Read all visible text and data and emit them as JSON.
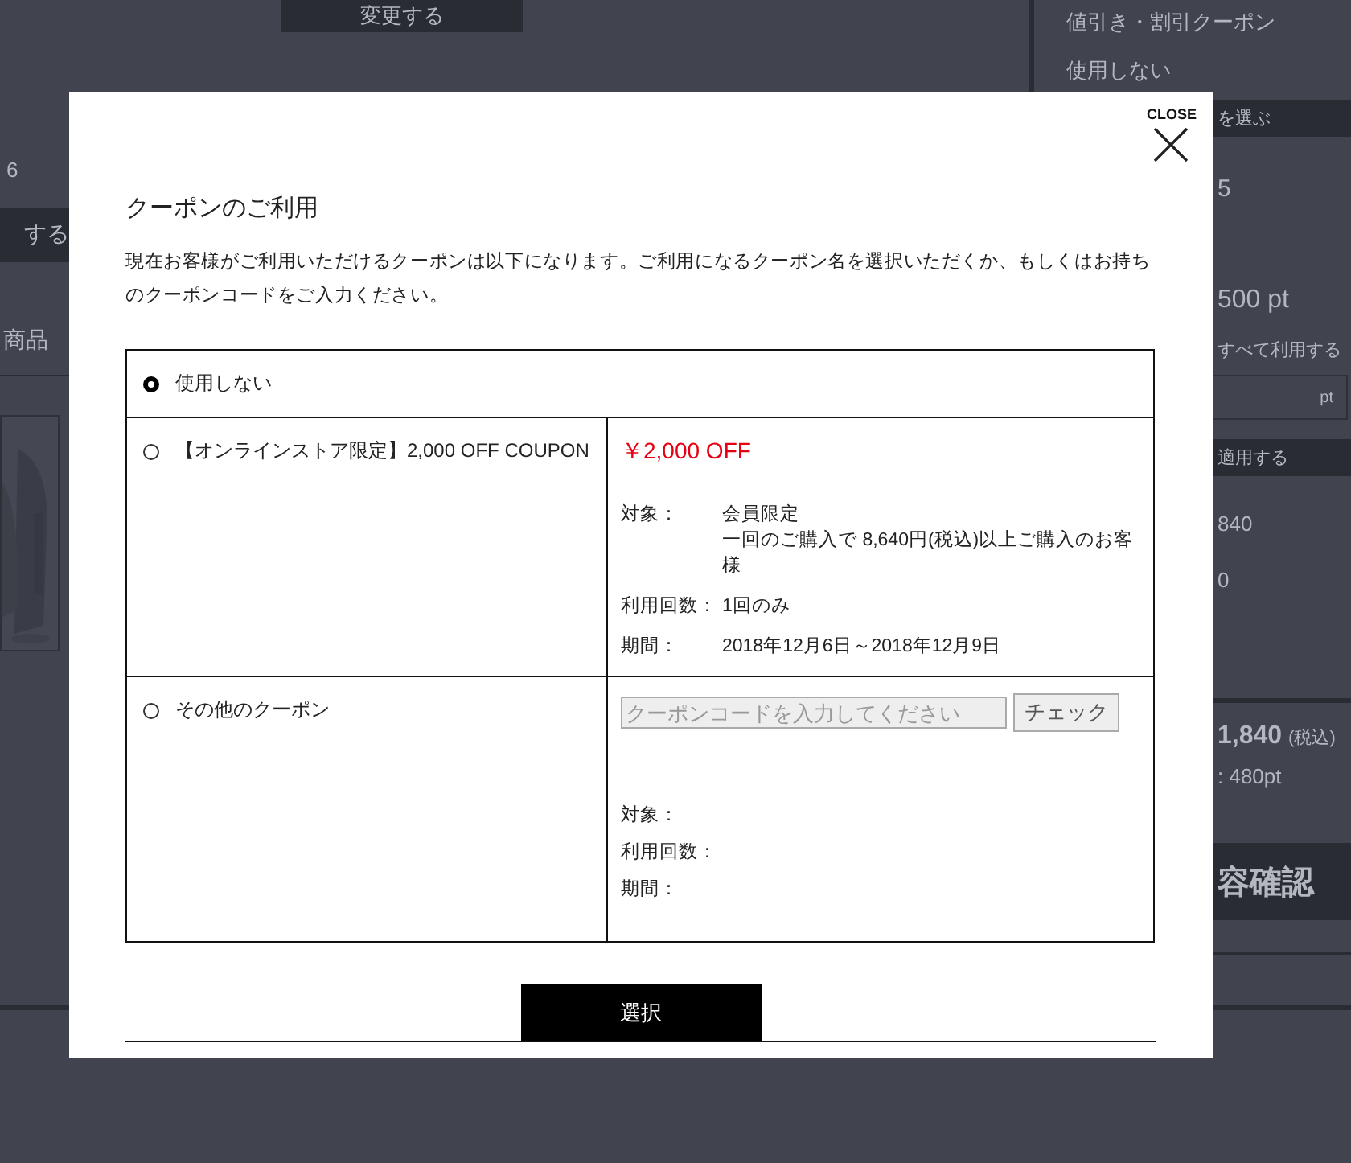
{
  "background": {
    "change_button": "変更する",
    "left_count": "6",
    "left_bar": "する",
    "left_heading": "商品",
    "coupon_heading": "値引き・割引クーポン",
    "coupon_value": "使用しない",
    "points_bar": "を選ぶ",
    "points_owned": "5",
    "points_amount": "500 pt",
    "use_all": "すべて利用する",
    "points_unit": "pt",
    "apply_bar": "適用する",
    "amount_1": "840",
    "amount_2": "0",
    "total": "1,840",
    "total_tax": "(税込)",
    "earned_points": ": 480pt",
    "confirm_bar": "容確認"
  },
  "modal": {
    "close_label": "CLOSE",
    "title": "クーポンのご利用",
    "description": "現在お客様がご利用いただけるクーポンは以下になります。ご利用になるクーポン名を選択いただくか、もしくはお持ちのクーポンコードをご入力ください。",
    "options": [
      {
        "kind": "none",
        "label": "使用しない",
        "selected": true
      },
      {
        "kind": "coupon",
        "label": "【オンラインストア限定】2,000 OFF COUPON",
        "selected": false,
        "discount": "￥2,000 OFF",
        "details": [
          {
            "label": "対象：",
            "lines": [
              "会員限定",
              "一回のご購入で 8,640円(税込)以上ご購入のお客様"
            ]
          },
          {
            "label": "利用回数：",
            "lines": [
              "1回のみ"
            ]
          },
          {
            "label": "期間：",
            "lines": [
              "2018年12月6日～2018年12月9日"
            ]
          }
        ]
      },
      {
        "kind": "code",
        "label": "その他のクーポン",
        "selected": false,
        "placeholder": "クーポンコードを入力してください",
        "check_button": "チェック",
        "details": [
          {
            "label": "対象："
          },
          {
            "label": "利用回数："
          },
          {
            "label": "期間："
          }
        ]
      }
    ],
    "submit": "選択"
  }
}
